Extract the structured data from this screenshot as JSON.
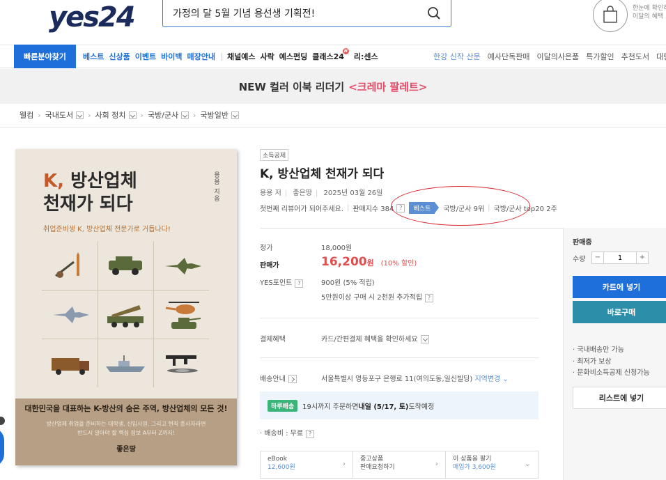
{
  "header": {
    "logo": "yes24",
    "search_value": "가정의 달 5월 기념 용선생 기획전!",
    "cart_caption_1": "한눈에 확인하",
    "cart_caption_2": "이달의 혜택 보"
  },
  "nav": {
    "quick": "빠른분야찾기",
    "primary": [
      "베스트",
      "신상품",
      "이벤트",
      "바이백",
      "매장안내"
    ],
    "secondary": [
      "채널예스",
      "사락",
      "예스펀딩",
      "클래스24",
      "리:센스"
    ],
    "right": [
      "한강 신작 산문",
      "예사단독판매",
      "이달의사은품",
      "특가할인",
      "추천도서",
      "대량"
    ]
  },
  "banner": {
    "text": "NEW 컬러 이북 리더기",
    "accent": "<크레마 팔레트>"
  },
  "breadcrumb": [
    "웰컴",
    "국내도서",
    "사회 정치",
    "국방/군사",
    "국방일반"
  ],
  "cover": {
    "title_k": "K,",
    "title_1": " 방산업체",
    "title_2": "천재가 되다",
    "author_vertical": "용용 지음",
    "subtitle": "취업준비생 K, 방산업체 전문가로 거듭나다!",
    "bottom_head": "대한민국을 대표하는 K-방산의 숨은 주역, 방산업체의 모든 것!",
    "bottom_line1": "방산업체 취업을 준비하는 대학생, 신입사원, 그리고 현직 종사자라면",
    "bottom_line2": "반드시 알아야 할 핵심 정보 A부터 Z까지!",
    "publisher": "좋은땅"
  },
  "product": {
    "tag": "소득공제",
    "title": "K, 방산업체 천재가 되다",
    "author": "용용 저",
    "publisher": "좋은땅",
    "date": "2025년 03월 26일",
    "review": "첫번째 리뷰어가 되어주세요.",
    "sales_index": "판매지수 384",
    "best_label": "베스트",
    "rank_1": "국방/군사 9위",
    "rank_2": "국방/군사 top20 2주"
  },
  "pricing": {
    "list_label": "정가",
    "list_value": "18,000원",
    "sale_label": "판매가",
    "sale_value": "16,200",
    "sale_unit": "원",
    "discount": "(10% 할인)",
    "point_label": "YES포인트",
    "point_value": "900원 (5% 적립)",
    "point_extra": "5만원이상 구매 시 2천원 추가적립",
    "pay_label": "결제혜택",
    "pay_value": "카드/간편결제 혜택을 확인하세요",
    "ship_label": "배송안내",
    "ship_address": "서울특별시 영등포구 은행로 11(여의도동,일신빌딩)",
    "ship_change": "지역변경",
    "delivery_chip": "하루배송",
    "delivery_pre": "19시까지 주문하면 ",
    "delivery_bold": "내일 (5/17, 토)",
    "delivery_post": " 도착예정",
    "fee": "· 배송비 : 무료"
  },
  "options": [
    {
      "l1": "eBook",
      "l2": "12,600원"
    },
    {
      "l1": "중고상품",
      "l2": "판매요청하기"
    },
    {
      "l1": "이 상품을 팔기",
      "l2": "매입가 3,600원"
    }
  ],
  "panel": {
    "status": "판매중",
    "qty_label": "수량",
    "qty": "1",
    "cart": "카트에 넣기",
    "buy": "바로구매",
    "bullets": [
      "· 국내배송만 가능",
      "· 최저가 보상",
      "· 문화비소득공제 신청가능"
    ],
    "list": "리스트에 넣기"
  },
  "colors": {
    "accent_blue": "#1e6fd9",
    "sale_red": "#e04f4f",
    "annotation_red": "#d9262e"
  }
}
